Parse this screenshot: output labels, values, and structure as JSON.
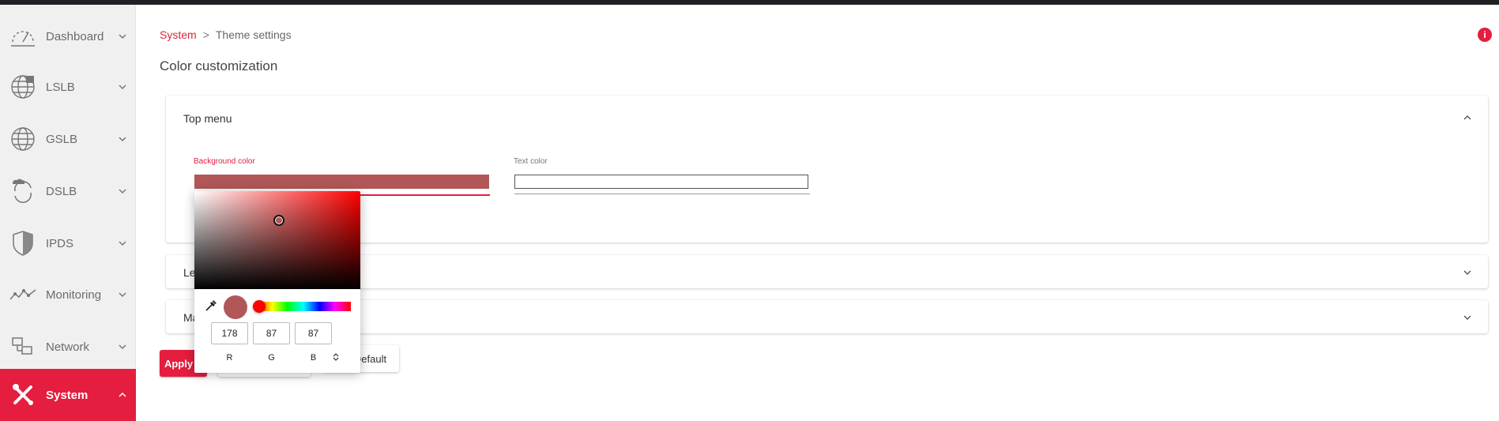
{
  "sidebar": {
    "items": [
      {
        "label": "Dashboard",
        "icon": "dashboard-gauge-icon"
      },
      {
        "label": "LSLB",
        "icon": "lslb-globe-icon"
      },
      {
        "label": "GSLB",
        "icon": "gslb-globe-icon"
      },
      {
        "label": "DSLB",
        "icon": "dslb-cloud-sync-icon"
      },
      {
        "label": "IPDS",
        "icon": "ipds-shield-icon"
      },
      {
        "label": "Monitoring",
        "icon": "monitoring-pulse-icon"
      },
      {
        "label": "Network",
        "icon": "network-monitors-icon"
      },
      {
        "label": "System",
        "icon": "system-tools-icon"
      }
    ],
    "active_item": "System"
  },
  "breadcrumb": {
    "parent": "System",
    "separator": ">",
    "current": "Theme settings"
  },
  "info_icon": {
    "glyph": "i"
  },
  "page": {
    "title": "Color customization"
  },
  "panels": {
    "top_menu": {
      "title": "Top menu",
      "background_color": {
        "label": "Background color",
        "value": "#b25757"
      },
      "text_color": {
        "label": "Text color",
        "value": "#ffffff"
      }
    },
    "panel2": {
      "title_partial": "Le"
    },
    "panel3": {
      "title_partial": "Ma"
    }
  },
  "buttons": {
    "apply": "Apply",
    "default_partial": "Default"
  },
  "color_picker": {
    "r": "178",
    "g": "87",
    "b": "87",
    "r_label": "R",
    "g_label": "G",
    "b_label": "B",
    "hue": "#ff0000"
  },
  "colors": {
    "accent": "#e51d3f",
    "accent_text": "#d6283a",
    "sidebar_bg": "#f0f0f0",
    "selected_color": "#b25757"
  }
}
